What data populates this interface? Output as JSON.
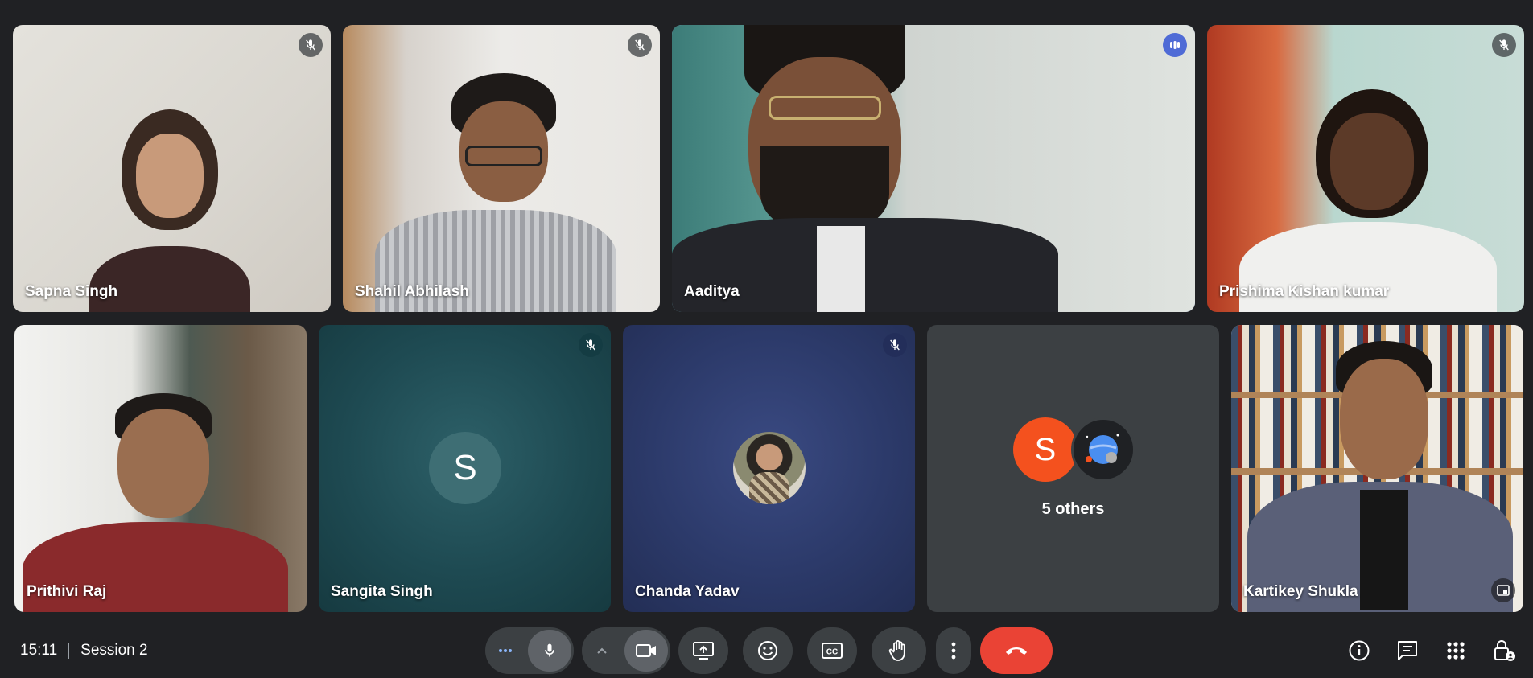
{
  "meeting": {
    "time": "15:11",
    "session": "Session 2"
  },
  "participants": [
    {
      "name": "Sapna Singh",
      "mic": "muted"
    },
    {
      "name": "Shahil Abhilash",
      "mic": "muted"
    },
    {
      "name": "Aaditya",
      "mic": "speaking"
    },
    {
      "name": "Prishima Kishan kumar",
      "mic": "muted"
    },
    {
      "name": "Prithivi Raj",
      "mic": "on"
    },
    {
      "name": "Sangita Singh",
      "mic": "muted",
      "avatar_letter": "S"
    },
    {
      "name": "Chanda Yadav",
      "mic": "muted"
    },
    {
      "name": "Kartikey Shukla",
      "mic": "on"
    }
  ],
  "others": {
    "label": "5 others",
    "avatar_letter": "S"
  },
  "controls": [
    {
      "icon": "more-dots-icon",
      "label": "Audio settings"
    },
    {
      "icon": "microphone-icon",
      "label": "Microphone"
    },
    {
      "icon": "chevron-up-icon",
      "label": "Video settings"
    },
    {
      "icon": "camera-icon",
      "label": "Camera"
    },
    {
      "icon": "present-screen-icon",
      "label": "Present"
    },
    {
      "icon": "emoji-icon",
      "label": "Reactions"
    },
    {
      "icon": "captions-icon",
      "label": "Captions"
    },
    {
      "icon": "raise-hand-icon",
      "label": "Raise hand"
    },
    {
      "icon": "more-options-icon",
      "label": "More options"
    },
    {
      "icon": "leave-call-icon",
      "label": "Leave call"
    }
  ],
  "colors": {
    "background": "#202124",
    "leave_red": "#ea4335",
    "active_outline": "#a8c7fa",
    "sangita_tile": "#1e4a52",
    "chanda_tile": "#2c3a6a",
    "others_avatar": "#f4511e"
  }
}
